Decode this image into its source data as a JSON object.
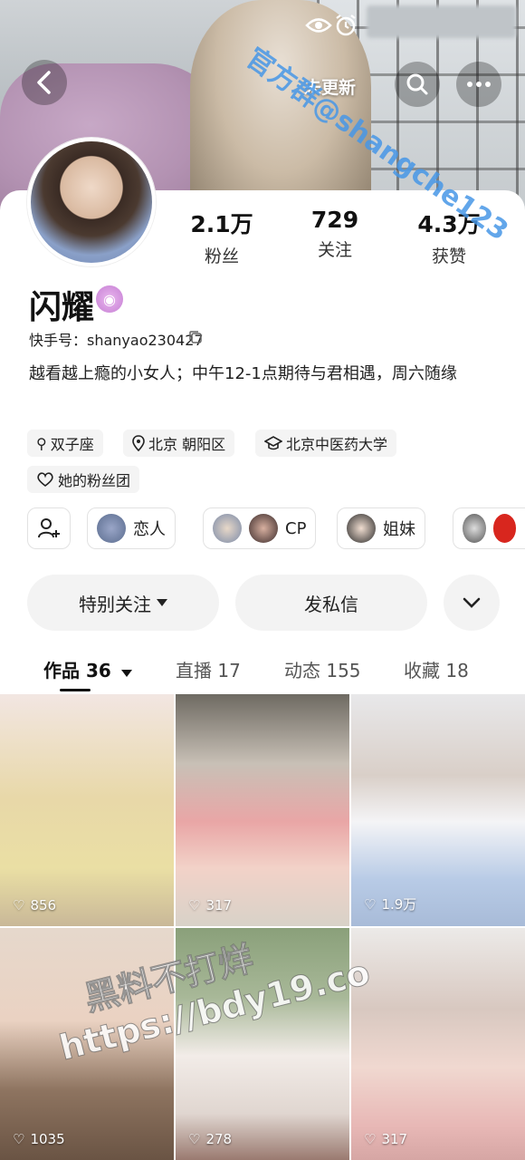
{
  "header": {
    "not_updated_label": "未更新",
    "watermark": "官方群@shangche123"
  },
  "stats": [
    {
      "value": "2.1万",
      "label": "粉丝"
    },
    {
      "value": "729",
      "label": "关注"
    },
    {
      "value": "4.3万",
      "label": "获赞"
    }
  ],
  "profile": {
    "nickname": "闪耀",
    "kuaishou_id": "快手号：shanyao230427",
    "bio": "越看越上瘾的小女人；中午12-1点期待与君相遇，周六随缘"
  },
  "tags": [
    {
      "icon": "zodiac-icon",
      "label": "双子座"
    },
    {
      "icon": "location-icon",
      "label": "北京 朝阳区"
    },
    {
      "icon": "school-icon",
      "label": "北京中医药大学"
    },
    {
      "icon": "fan-group-icon",
      "label": "她的粉丝团"
    }
  ],
  "relations": [
    {
      "label": "恋人"
    },
    {
      "label": "CP"
    },
    {
      "label": "姐妹"
    }
  ],
  "actions": {
    "special_follow": "特别关注",
    "message": "发私信"
  },
  "tabs": [
    {
      "label": "作品 36"
    },
    {
      "label": "直播 17"
    },
    {
      "label": "动态 155"
    },
    {
      "label": "收藏 18"
    }
  ],
  "videos": [
    {
      "likes": "856"
    },
    {
      "likes": "317"
    },
    {
      "likes": "1.9万"
    },
    {
      "likes": "1035"
    },
    {
      "likes": "278"
    },
    {
      "likes": "317"
    }
  ],
  "bottom_watermark": {
    "line1": "黑料不打烊",
    "line2": "https://bdy19.co"
  },
  "colors": {
    "badge": "#c67fd4",
    "watermark_top": "#4696e6"
  }
}
